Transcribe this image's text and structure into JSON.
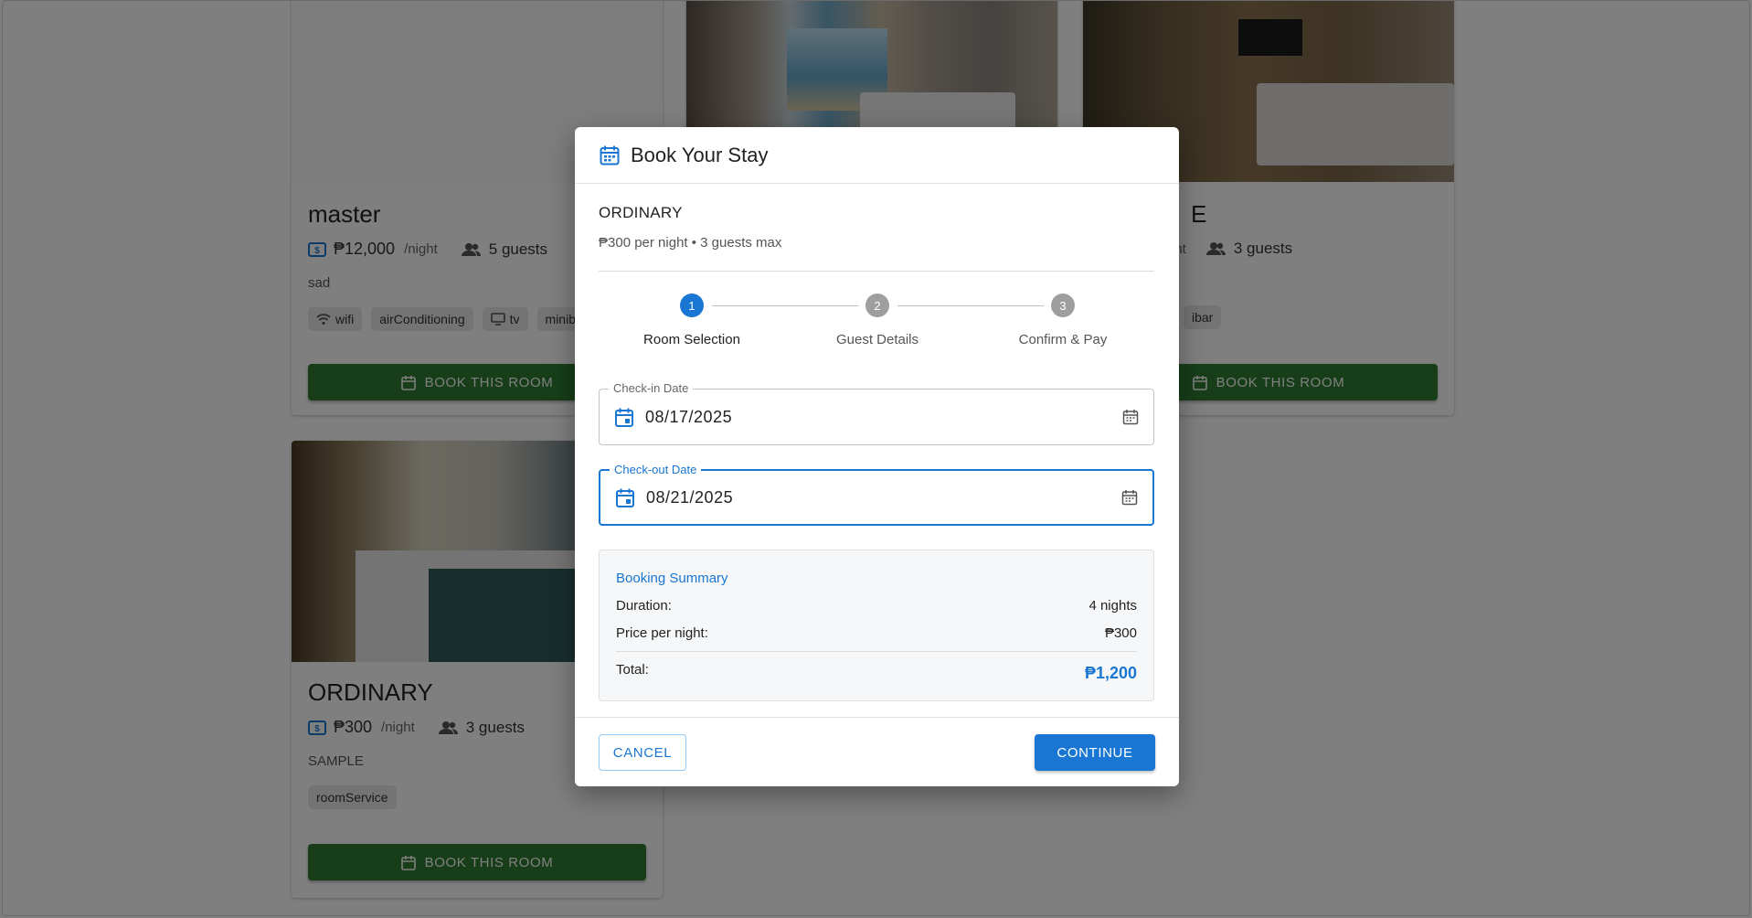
{
  "background": {
    "cards": [
      {
        "title": "master",
        "price": "₱12,000",
        "per_night": "/night",
        "guests": "5 guests",
        "description": "sad",
        "amenities": [
          "wifi",
          "airConditioning",
          "tv",
          "minib"
        ],
        "book_label": "BOOK THIS ROOM"
      },
      {
        "title_partial": "E",
        "per_night_partial": "ght",
        "guests": "3 guests",
        "amenity_partial": "ibar",
        "book_label": "BOOK THIS ROOM"
      },
      {
        "title": "ORDINARY",
        "price": "₱300",
        "per_night": "/night",
        "guests": "3 guests",
        "description": "SAMPLE",
        "amenities": [
          "roomService"
        ],
        "book_label": "BOOK THIS ROOM"
      }
    ]
  },
  "dialog": {
    "title": "Book Your Stay",
    "room_name": "ORDINARY",
    "room_subtitle": "₱300 per night • 3 guests max",
    "steps": [
      {
        "number": "1",
        "label": "Room Selection",
        "active": true
      },
      {
        "number": "2",
        "label": "Guest Details",
        "active": false
      },
      {
        "number": "3",
        "label": "Confirm & Pay",
        "active": false
      }
    ],
    "checkin": {
      "label": "Check-in Date",
      "value": "08/17/2025"
    },
    "checkout": {
      "label": "Check-out Date",
      "value": "08/21/2025"
    },
    "summary": {
      "title": "Booking Summary",
      "duration_label": "Duration:",
      "duration_value": "4 nights",
      "price_label": "Price per night:",
      "price_value": "₱300",
      "total_label": "Total:",
      "total_value": "₱1,200"
    },
    "cancel_label": "CANCEL",
    "continue_label": "CONTINUE"
  },
  "colors": {
    "primary": "#1976d2",
    "book_button": "#2e7d32",
    "step_inactive": "#9e9e9e"
  }
}
